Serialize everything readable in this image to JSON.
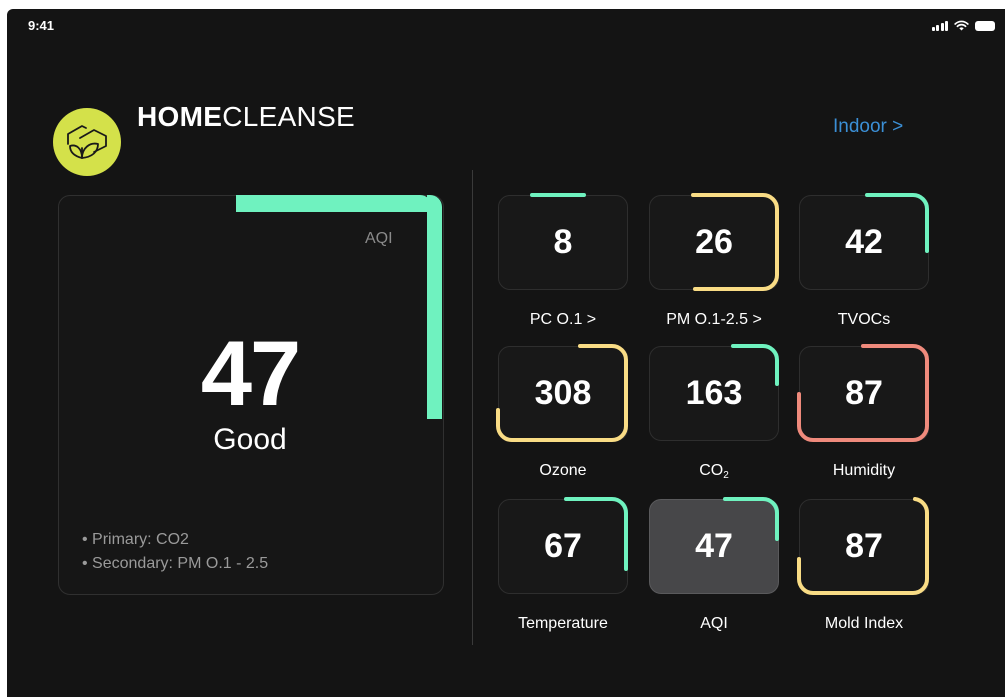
{
  "status": {
    "time": "9:41"
  },
  "brand": {
    "logo_icon": "leaf-house-icon",
    "name_bold": "HOME",
    "name_light": "CLEANSE"
  },
  "environment_link": "Indoor >",
  "summary": {
    "label": "AQI",
    "value": "47",
    "status": "Good",
    "notes": [
      "• Primary: CO2",
      "• Secondary:  PM O.1 - 2.5"
    ],
    "accent": "#6ff2bf"
  },
  "colors": {
    "green": "#6ff2bf",
    "yellow": "#f9dc85",
    "red": "#ef8a7c",
    "brand": "#d4e14a",
    "link": "#3b8fd6"
  },
  "metrics": [
    {
      "value": "8",
      "label": "PC O.1 >",
      "color": "#6ff2bf",
      "level": 0.15
    },
    {
      "value": "26",
      "label": "PM O.1-2.5 >",
      "color": "#f9dc85",
      "level": 0.55
    },
    {
      "value": "42",
      "label": "TVOCs",
      "color": "#6ff2bf",
      "level": 0.35
    },
    {
      "value": "308",
      "label": "Ozone",
      "color": "#f9dc85",
      "level": 0.8
    },
    {
      "value": "163",
      "label": "CO",
      "label_sub": "2",
      "color": "#6ff2bf",
      "level": 0.3
    },
    {
      "value": "87",
      "label": "Humidity",
      "color": "#ef8a7c",
      "level": 0.85
    },
    {
      "value": "67",
      "label": "Temperature",
      "color": "#6ff2bf",
      "level": 0.35,
      "selected": false
    },
    {
      "value": "47",
      "label": "AQI",
      "color": "#6ff2bf",
      "level": 0.3,
      "selected": true
    },
    {
      "value": "87",
      "label": "Mold Index",
      "color": "#f9dc85",
      "level": 0.6
    }
  ]
}
